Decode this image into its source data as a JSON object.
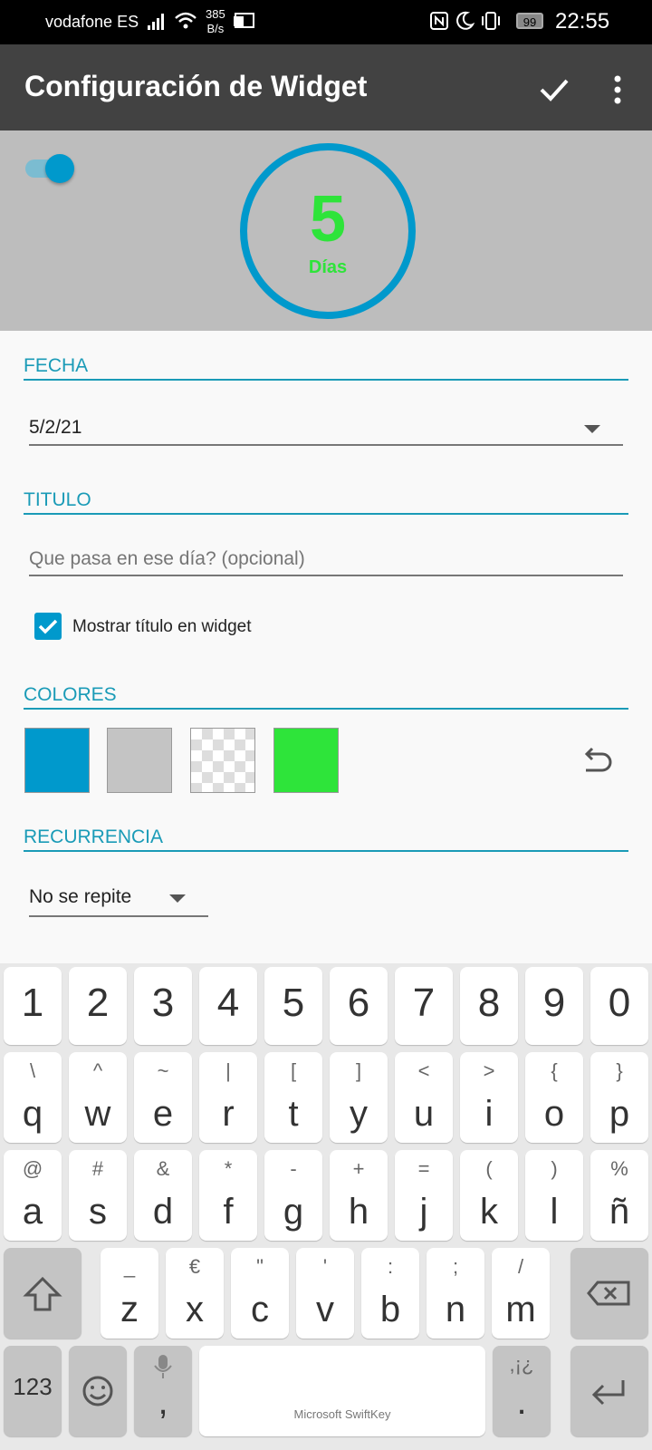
{
  "status_bar": {
    "carrier": "vodafone ES",
    "net_speed_value": "385",
    "net_speed_unit": "B/s",
    "battery": "99",
    "time": "22:55"
  },
  "app_bar": {
    "title": "Configuración de Widget",
    "confirm_icon": "check-icon",
    "more_icon": "more-vert-icon"
  },
  "preview": {
    "toggle_on": true,
    "count": "5",
    "unit": "Días",
    "ring_color": "#0099cc",
    "text_color": "#2ee43a"
  },
  "form": {
    "date_header": "FECHA",
    "date_value": "5/2/21",
    "title_header": "TITULO",
    "title_placeholder": "Que pasa en ese día? (opcional)",
    "title_value": "",
    "show_title_label": "Mostrar título en widget",
    "show_title_checked": true,
    "colors_header": "COLORES",
    "colors": [
      "#0099cc",
      "#c4c4c4",
      "transparent",
      "#2ee43a"
    ],
    "recurrence_header": "RECURRENCIA",
    "recurrence_value": "No se repite"
  },
  "keyboard": {
    "numbers": [
      "1",
      "2",
      "3",
      "4",
      "5",
      "6",
      "7",
      "8",
      "9",
      "0"
    ],
    "row1": [
      "q",
      "w",
      "e",
      "r",
      "t",
      "y",
      "u",
      "i",
      "o",
      "p"
    ],
    "row1_alt": [
      "\\",
      "^",
      "~",
      "|",
      "[",
      "]",
      "<",
      ">",
      "{",
      "}"
    ],
    "row2": [
      "a",
      "s",
      "d",
      "f",
      "g",
      "h",
      "j",
      "k",
      "l",
      "ñ"
    ],
    "row2_alt": [
      "@",
      "#",
      "&",
      "*",
      "-",
      "+",
      "=",
      "(",
      ")",
      "%"
    ],
    "row3": [
      "z",
      "x",
      "c",
      "v",
      "b",
      "n",
      "m"
    ],
    "row3_alt": [
      "_",
      "€",
      "\"",
      "'",
      ":",
      ";",
      "/"
    ],
    "mode_key": "123",
    "comma_key": ",",
    "space_label": "Microsoft SwiftKey",
    "period_key": ".",
    "period_alt": ",¡¿"
  }
}
